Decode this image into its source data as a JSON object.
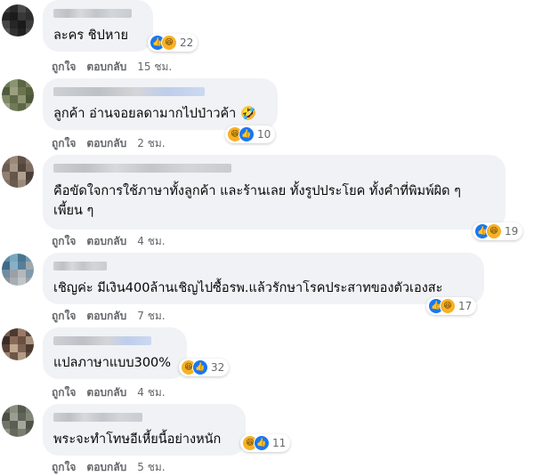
{
  "comments": [
    {
      "text_lines": [
        "ละคร ชิปหาย"
      ],
      "reaction_count": "22",
      "reactions": [
        "like",
        "haha"
      ],
      "like_label": "ถูกใจ",
      "reply_label": "ตอบกลับ",
      "time": "15 ชม."
    },
    {
      "text_lines": [
        "ลูกค้า อ่านจอยลดามากไปป่าวค้า 🤣"
      ],
      "reaction_count": "10",
      "reactions": [
        "haha",
        "like"
      ],
      "like_label": "ถูกใจ",
      "reply_label": "ตอบกลับ",
      "time": "2 ชม."
    },
    {
      "text_lines": [
        "คือขัดใจการใช้ภาษาทั้งลูกค้า และร้านเลย ทั้งรูปประโยค ทั้งคำที่พิมพ์ผิด ๆ",
        "เพี้ยน ๆ"
      ],
      "reaction_count": "19",
      "reactions": [
        "like",
        "haha"
      ],
      "like_label": "ถูกใจ",
      "reply_label": "ตอบกลับ",
      "time": "4 ชม."
    },
    {
      "text_lines": [
        "เชิญค่ะ มีเงิน400ล้านเชิญไปซื้อรพ.แล้วรักษาโรคประสาทของตัวเองสะ"
      ],
      "reaction_count": "17",
      "reactions": [
        "like",
        "haha"
      ],
      "like_label": "ถูกใจ",
      "reply_label": "ตอบกลับ",
      "time": "7 ชม."
    },
    {
      "text_lines": [
        "แปลภาษาแบบ300%"
      ],
      "reaction_count": "32",
      "reactions": [
        "haha",
        "like"
      ],
      "like_label": "ถูกใจ",
      "reply_label": "ตอบกลับ",
      "time": "4 ชม."
    },
    {
      "text_lines": [
        "พระจะทำโทษอีเหี้ยนี้อย่างหนัก"
      ],
      "reaction_count": "11",
      "reactions": [
        "haha",
        "like"
      ],
      "like_label": "ถูกใจ",
      "reply_label": "ตอบกลับ",
      "time": "5 ชม."
    }
  ],
  "icons": {
    "like": "like-icon",
    "haha": "haha-icon"
  },
  "colors": {
    "bubble": "#f0f2f5",
    "like": "#1877f2",
    "haha": "#f7b125",
    "meta_text": "#65676b"
  }
}
